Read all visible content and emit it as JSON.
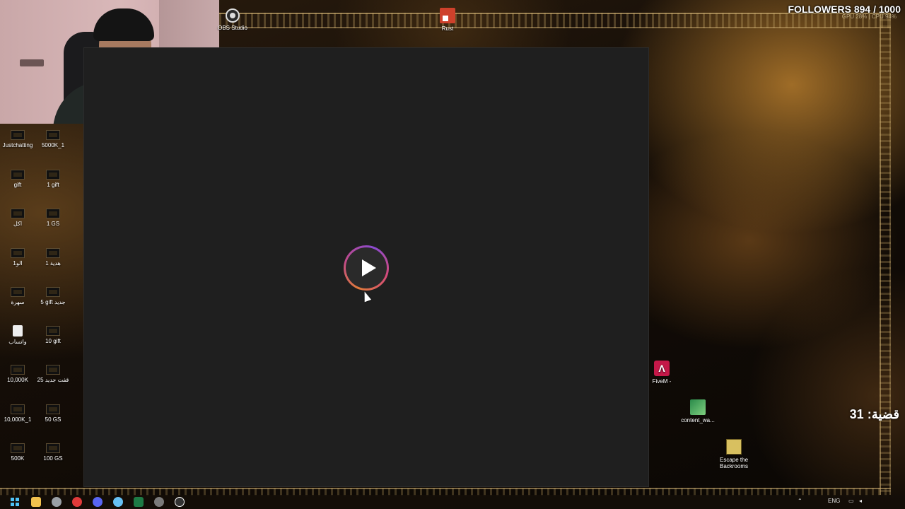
{
  "overlay": {
    "followers": "FOLLOWERS 894 / 1000",
    "system_stats": "GPU 28%  |  CPU 94%",
    "counter": "قضية: 31"
  },
  "desktop_icons": {
    "top": [
      {
        "label": "OBS Studio",
        "icon": "obs-icon"
      },
      {
        "label": "Rust",
        "icon": "rust-icon"
      }
    ],
    "left_col1": [
      "Justchatting",
      "gift",
      "اكل",
      "1الو",
      "سهرة",
      "واتساب",
      "10,000K",
      "10,000K_1",
      "500K"
    ],
    "left_col2": [
      "5000K_1",
      "1 gift",
      "1 GS",
      "1 هدية",
      "5 gift جديد",
      "10 gift",
      "25 قفت جديد",
      "50 GS",
      "100 GS"
    ],
    "right": [
      {
        "label": "FiveM -",
        "icon": "fivem-icon"
      },
      {
        "label": "content_wa...",
        "icon": "content-warning-icon"
      },
      {
        "label": "Escape the Backrooms",
        "icon": "escape-backrooms-icon"
      }
    ]
  },
  "taskbar": {
    "language": "ENG",
    "apps": [
      "start-icon",
      "file-explorer-icon",
      "settings-icon",
      "opera-icon",
      "discord-icon",
      "steam-icon",
      "excel-icon",
      "obs-icon",
      "media-player-icon"
    ],
    "colors": [
      "#4fc3f7",
      "#f2c14e",
      "#9aa0a6",
      "#e03a3a",
      "#5865f2",
      "#66c0f4",
      "#1d7a45",
      "#7a7a7a",
      "#ffffff"
    ]
  }
}
